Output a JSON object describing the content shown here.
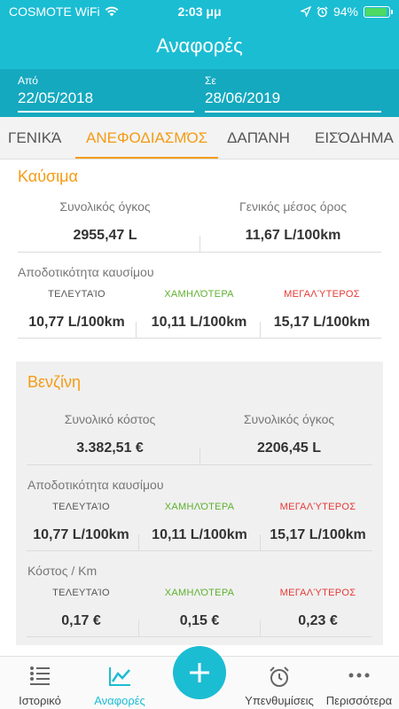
{
  "status": {
    "carrier": "COSMOTE WiFi",
    "time": "2:03 μμ",
    "battery": "94%",
    "battery_level": 0.94
  },
  "nav": {
    "title": "Αναφορές"
  },
  "dates": {
    "from_label": "Από",
    "from": "22/05/2018",
    "to_label": "Σε",
    "to": "28/06/2019"
  },
  "tabs": [
    "ΓΕΝΙΚΆ",
    "ΑΝΕΦΟΔΙΑΣΜΌΣ",
    "ΔΑΠΆΝΗ",
    "ΕΙΣΌΔΗΜΑ"
  ],
  "fuel": {
    "title": "Καύσιμα",
    "total_volume_label": "Συνολικός όγκος",
    "total_volume": "2955,47 L",
    "avg_label": "Γενικός μέσος όρος",
    "avg": "11,67 L/100km",
    "efficiency_label": "Αποδοτικότητα καυσίμου",
    "last_label": "ΤΕΛΕΥΤΑΊΟ",
    "lowest_label": "ΧΑΜΗΛΌΤΕΡΑ",
    "highest_label": "ΜΕΓΑΛΎΤΕΡΟΣ",
    "last": "10,77 L/100km",
    "lowest": "10,11 L/100km",
    "highest": "15,17 L/100km"
  },
  "petrol": {
    "title": "Βενζίνη",
    "total_cost_label": "Συνολικό κόστος",
    "total_cost": "3.382,51 €",
    "total_volume_label": "Συνολικός όγκος",
    "total_volume": "2206,45 L",
    "efficiency_label": "Αποδοτικότητα καυσίμου",
    "last_label": "ΤΕΛΕΥΤΑΊΟ",
    "lowest_label": "ΧΑΜΗΛΌΤΕΡΑ",
    "highest_label": "ΜΕΓΑΛΎΤΕΡΟΣ",
    "eff_last": "10,77 L/100km",
    "eff_lowest": "10,11 L/100km",
    "eff_highest": "15,17 L/100km",
    "cost_km_label": "Κόστος / Km",
    "cost_last": "0,17 €",
    "cost_lowest": "0,15 €",
    "cost_highest": "0,23 €"
  },
  "tabbar": {
    "history": "Ιστορικό",
    "reports": "Αναφορές",
    "reminders": "Υπενθυμίσεις",
    "more": "Περισσότερα"
  },
  "colors": {
    "primary": "#1bbdd3",
    "primary_dark": "#15a9bf",
    "accent": "#f49b13",
    "green": "#5db12f",
    "red": "#e53935"
  }
}
